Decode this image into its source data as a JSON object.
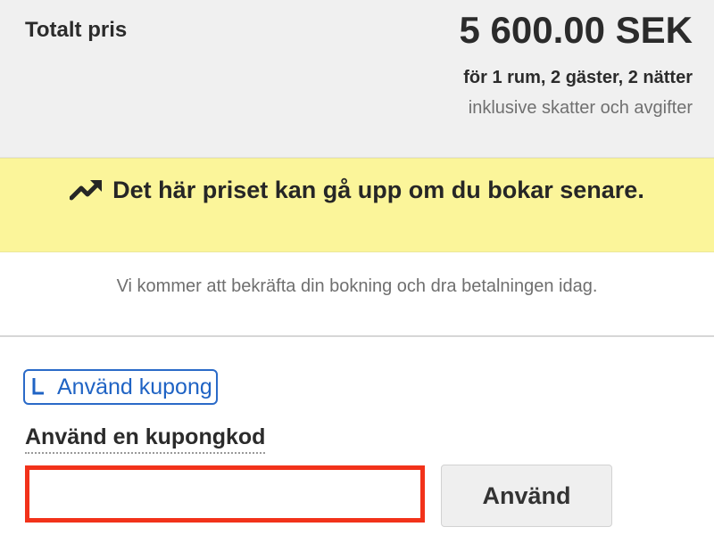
{
  "price_summary": {
    "label": "Totalt pris",
    "amount": "5 600.00 SEK",
    "detail": "för 1 rum, 2 gäster, 2 nätter",
    "note": "inklusive skatter och avgifter"
  },
  "warning": {
    "icon": "trending-up-icon",
    "text": "Det här priset kan gå upp om du bokar senare.",
    "background_color": "#fbf59a"
  },
  "confirmation": {
    "text": "Vi kommer att bekräfta din bokning och dra betalningen idag."
  },
  "coupon": {
    "toggle_label": "Använd kupong",
    "toggle_icon": "checkbox-bracket-icon",
    "field_label": "Använd en kupongkod",
    "input_value": "",
    "input_placeholder": "",
    "apply_label": "Använd",
    "link_color": "#1f63c4",
    "highlight_color": "#f2321a"
  }
}
